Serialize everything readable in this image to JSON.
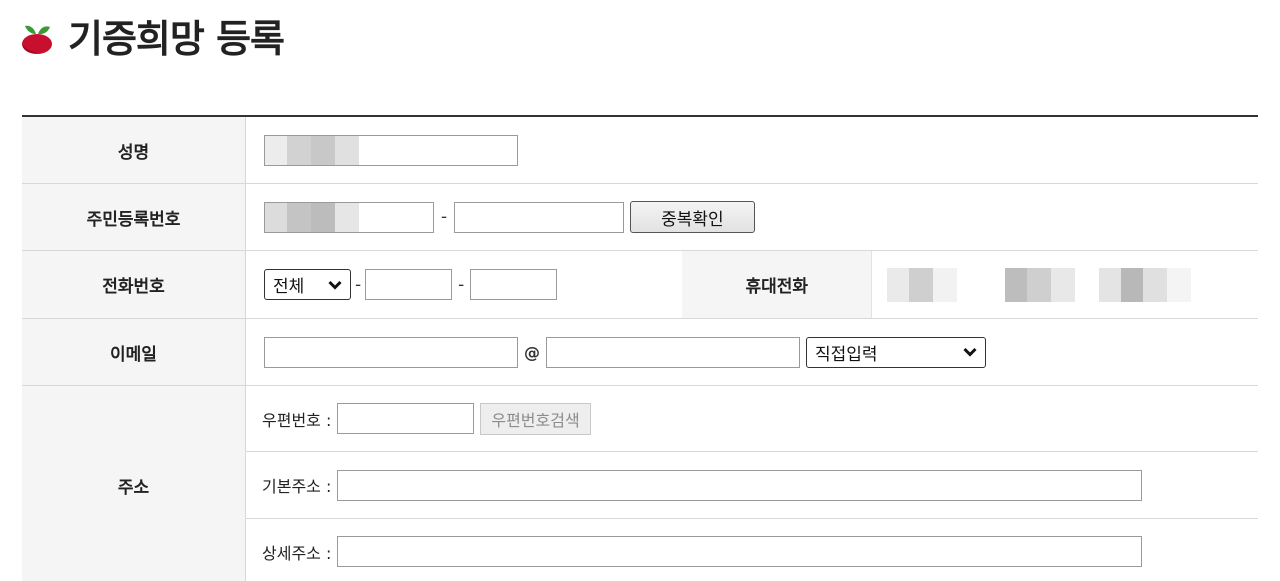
{
  "header": {
    "title": "기증희망 등록",
    "logo_icon": "sprout-berry-icon",
    "brand_color": "#c8102e",
    "leaf_color": "#3a9a35"
  },
  "form": {
    "name": {
      "label": "성명",
      "value": ""
    },
    "rrn": {
      "label": "주민등록번호",
      "first": "",
      "second": "",
      "separator": "-",
      "check_button": "중복확인"
    },
    "phone": {
      "label": "전화번호",
      "area_selected": "전체",
      "middle": "",
      "last": "",
      "separator": "-",
      "mobile_label": "휴대전화"
    },
    "email": {
      "label": "이메일",
      "local": "",
      "at": "@",
      "domain": "",
      "domain_selected": "직접입력"
    },
    "address": {
      "label": "주소",
      "zip_label": "우편번호 :",
      "zip_value": "",
      "zip_search_button": "우편번호검색",
      "base_label": "기본주소 :",
      "base_value": "",
      "detail_label": "상세주소 :",
      "detail_value": ""
    }
  }
}
